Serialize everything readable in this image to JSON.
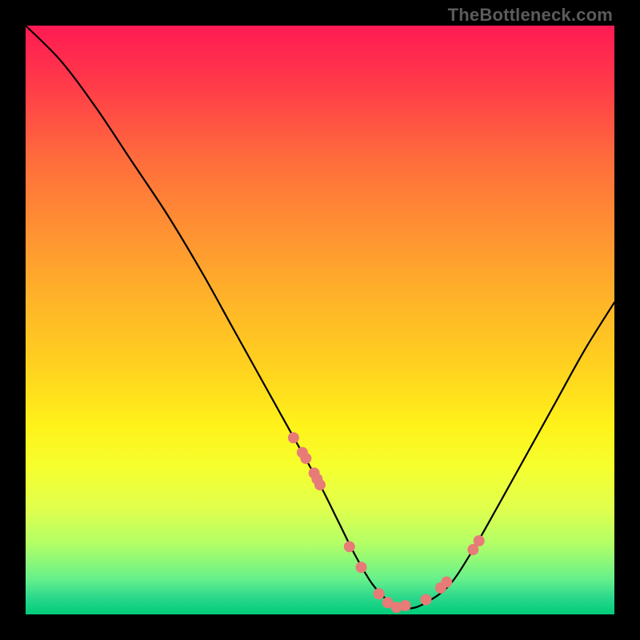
{
  "watermark": "TheBottleneck.com",
  "chart_data": {
    "type": "line",
    "title": "",
    "xlabel": "",
    "ylabel": "",
    "xlim": [
      0,
      100
    ],
    "ylim": [
      0,
      100
    ],
    "grid": false,
    "legend": false,
    "curve": {
      "name": "bottleneck-curve",
      "x": [
        0,
        6,
        12,
        18,
        24,
        30,
        35,
        40,
        45,
        50,
        53,
        56,
        59,
        62,
        65,
        68,
        72,
        76,
        80,
        85,
        90,
        95,
        100
      ],
      "y": [
        100,
        94,
        86,
        77,
        68,
        58,
        49,
        40,
        31,
        22,
        16,
        10,
        5,
        2,
        1,
        2,
        5,
        11,
        18,
        27,
        36,
        45,
        53
      ]
    },
    "points": {
      "name": "marked-points",
      "x": [
        45.5,
        47.0,
        47.6,
        49.0,
        49.5,
        50.0,
        55.0,
        57.0,
        60.0,
        61.5,
        63.0,
        64.5,
        68.0,
        70.5,
        71.5,
        76.0,
        77.0
      ],
      "y": [
        30.0,
        27.5,
        26.5,
        24.0,
        23.0,
        22.0,
        11.5,
        8.0,
        3.5,
        2.0,
        1.2,
        1.5,
        2.5,
        4.5,
        5.5,
        11.0,
        12.5
      ]
    },
    "gradient_colors": {
      "top": "#ff1a54",
      "upper_mid": "#ffb229",
      "mid": "#fff21a",
      "lower_mid": "#b3ff66",
      "bottom": "#00cc7a"
    }
  }
}
